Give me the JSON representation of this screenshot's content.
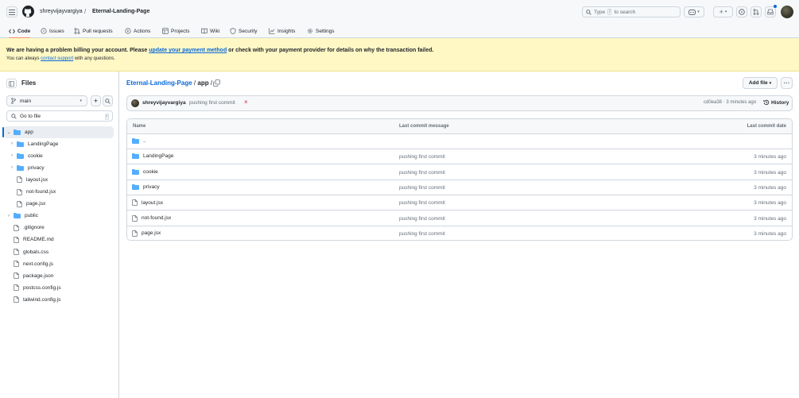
{
  "header": {
    "owner": "shreyvijayvargiya",
    "separator": "/",
    "repo": "Eternal-Landing-Page",
    "search_type": "Type",
    "search_key": "/",
    "search_suffix": "to search",
    "plus_label": "+"
  },
  "tabs": [
    {
      "label": "Code",
      "icon": "code-icon"
    },
    {
      "label": "Issues",
      "icon": "issue-icon"
    },
    {
      "label": "Pull requests",
      "icon": "pull-request-icon"
    },
    {
      "label": "Actions",
      "icon": "play-icon"
    },
    {
      "label": "Projects",
      "icon": "table-icon"
    },
    {
      "label": "Wiki",
      "icon": "book-icon"
    },
    {
      "label": "Security",
      "icon": "shield-icon"
    },
    {
      "label": "Insights",
      "icon": "graph-icon"
    },
    {
      "label": "Settings",
      "icon": "gear-icon"
    }
  ],
  "banner": {
    "line1_pre": "We are having a problem billing your account. Please ",
    "line1_link": "update your payment method",
    "line1_post": " or check with your payment provider for details on why the transaction failed.",
    "line2_pre": "You can always ",
    "line2_link": "contact support",
    "line2_post": " with any questions.",
    "bg_color": "#fff8c5"
  },
  "sidebar": {
    "title": "Files",
    "branch": "main",
    "goto_placeholder": "Go to file",
    "goto_key": "t",
    "plus_label": "+",
    "tree": [
      {
        "name": "app",
        "type": "folder",
        "expanded": true,
        "selected": true
      },
      {
        "name": "LandingPage",
        "type": "folder"
      },
      {
        "name": "cookie",
        "type": "folder"
      },
      {
        "name": "privacy",
        "type": "folder"
      },
      {
        "name": "layout.jsx",
        "type": "file"
      },
      {
        "name": "not-found.jsx",
        "type": "file"
      },
      {
        "name": "page.jsx",
        "type": "file"
      },
      {
        "name": "public",
        "type": "folder"
      },
      {
        "name": ".gitignore",
        "type": "file"
      },
      {
        "name": "README.md",
        "type": "file"
      },
      {
        "name": "globals.css",
        "type": "file"
      },
      {
        "name": "next.config.js",
        "type": "file"
      },
      {
        "name": "package.json",
        "type": "file"
      },
      {
        "name": "postcss.config.js",
        "type": "file"
      },
      {
        "name": "tailwind.config.js",
        "type": "file"
      }
    ]
  },
  "main": {
    "breadcrumb_repo": "Eternal-Landing-Page",
    "breadcrumb_sep": "/",
    "breadcrumb_dir": "app",
    "breadcrumb_tail": "/",
    "add_file_label": "Add file",
    "more_label": "···",
    "commit": {
      "author": "shreyvijayvargiya",
      "message": "pushing first commit",
      "status": "×",
      "hash_time": "cd0ea38 · 3 minutes ago",
      "history_label": "History"
    },
    "table": {
      "headers": [
        "Name",
        "Last commit message",
        "Last commit date"
      ],
      "rows": [
        {
          "name": "..",
          "type": "folder",
          "message": "",
          "date": ""
        },
        {
          "name": "LandingPage",
          "type": "folder",
          "message": "pushing first commit",
          "date": "3 minutes ago"
        },
        {
          "name": "cookie",
          "type": "folder",
          "message": "pushing first commit",
          "date": "3 minutes ago"
        },
        {
          "name": "privacy",
          "type": "folder",
          "message": "pushing first commit",
          "date": "3 minutes ago"
        },
        {
          "name": "layout.jsx",
          "type": "file",
          "message": "pushing first commit",
          "date": "3 minutes ago"
        },
        {
          "name": "not-found.jsx",
          "type": "file",
          "message": "pushing first commit",
          "date": "3 minutes ago"
        },
        {
          "name": "page.jsx",
          "type": "file",
          "message": "pushing first commit",
          "date": "3 minutes ago"
        }
      ]
    }
  },
  "colors": {
    "accent": "#0969da",
    "folder": "#54aeff",
    "tab_underline": "#fd8c73",
    "error": "#cf222e"
  }
}
